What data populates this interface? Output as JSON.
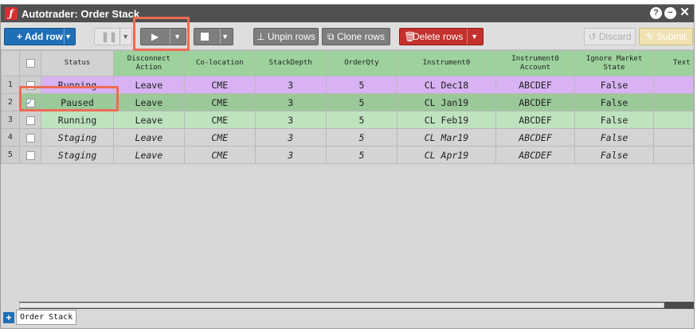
{
  "window": {
    "title": "Autotrader: Order Stack",
    "icons": [
      "help-icon",
      "minimize-icon",
      "close-icon"
    ]
  },
  "toolbar": {
    "add_row_label": "Add row",
    "pause_icon": "pause-icon",
    "play_icon": "play-icon",
    "stop_icon": "stop-icon",
    "unpin_label": "Unpin rows",
    "clone_label": "Clone rows",
    "delete_label": "Delete rows",
    "discard_label": "Discard",
    "submit_label": "Submit"
  },
  "grid": {
    "columns": [
      "Status",
      "Disconnect Action",
      "Co-location",
      "StackDepth",
      "OrderQty",
      "Instrument0",
      "Instrument0 Account",
      "Ignore Market State",
      "Text"
    ],
    "rows": [
      {
        "num": "1",
        "checked": false,
        "cells": [
          "Running",
          "Leave",
          "CME",
          "3",
          "5",
          "CL Dec18",
          "ABCDEF",
          "False",
          ""
        ]
      },
      {
        "num": "2",
        "checked": true,
        "cells": [
          "Paused",
          "Leave",
          "CME",
          "3",
          "5",
          "CL Jan19",
          "ABCDEF",
          "False",
          ""
        ]
      },
      {
        "num": "3",
        "checked": false,
        "cells": [
          "Running",
          "Leave",
          "CME",
          "3",
          "5",
          "CL Feb19",
          "ABCDEF",
          "False",
          ""
        ]
      },
      {
        "num": "4",
        "checked": false,
        "cells": [
          "Staging",
          "Leave",
          "CME",
          "3",
          "5",
          "CL Mar19",
          "ABCDEF",
          "False",
          ""
        ]
      },
      {
        "num": "5",
        "checked": false,
        "cells": [
          "Staging",
          "Leave",
          "CME",
          "3",
          "5",
          "CL Apr19",
          "ABCDEF",
          "False",
          ""
        ]
      }
    ]
  },
  "tabs": {
    "add_icon": "plus-icon",
    "items": [
      "Order Stack"
    ]
  },
  "colors": {
    "running": "#d8b2f3",
    "paused": "#9ac99a",
    "running_green": "#bfe2bf",
    "staging": "#d4d4d4",
    "highlight": "#ef6b55",
    "accent": "#1f6fb7"
  }
}
